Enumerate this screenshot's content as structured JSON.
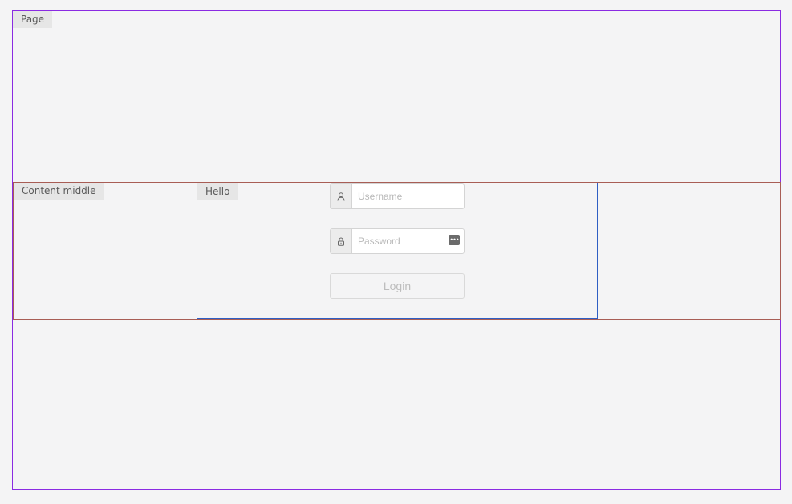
{
  "page": {
    "label": "Page"
  },
  "content_middle": {
    "label": "Content middle"
  },
  "hello": {
    "label": "Hello"
  },
  "login_form": {
    "username": {
      "icon": "user-icon",
      "placeholder": "Username",
      "value": ""
    },
    "password": {
      "icon": "lock-icon",
      "placeholder": "Password",
      "value": "",
      "toggle_icon": "password-toggle-icon",
      "toggle_glyph": "•••"
    },
    "login_button": {
      "label": "Login"
    }
  }
}
